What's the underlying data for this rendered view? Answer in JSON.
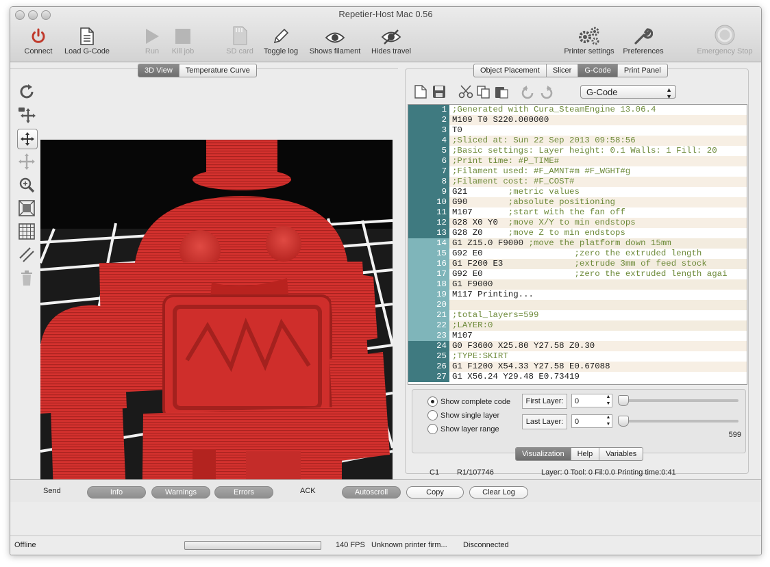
{
  "window": {
    "title": "Repetier-Host Mac 0.56"
  },
  "toolbar": [
    {
      "label": "Connect",
      "icon": "power-icon",
      "enabled": true
    },
    {
      "label": "Load G-Code",
      "icon": "document-icon",
      "enabled": true
    },
    {
      "label": "Run",
      "icon": "play-icon",
      "enabled": false
    },
    {
      "label": "Kill job",
      "icon": "stop-icon",
      "enabled": false
    },
    {
      "label": "SD card",
      "icon": "sd-card-icon",
      "enabled": false
    },
    {
      "label": "Toggle log",
      "icon": "pencil-icon",
      "enabled": true
    },
    {
      "label": "Shows filament",
      "icon": "eye-icon",
      "enabled": true
    },
    {
      "label": "Hides travel",
      "icon": "eye-slash-icon",
      "enabled": true
    },
    {
      "label": "Printer settings",
      "icon": "gears-icon",
      "enabled": true
    },
    {
      "label": "Preferences",
      "icon": "wrench-icon",
      "enabled": true
    },
    {
      "label": "Emergency Stop",
      "icon": "emergency-stop-icon",
      "enabled": false
    }
  ],
  "left_tabs": [
    {
      "label": "3D View",
      "active": true
    },
    {
      "label": "Temperature Curve",
      "active": false
    }
  ],
  "right_tabs": [
    {
      "label": "Object Placement",
      "active": false
    },
    {
      "label": "Slicer",
      "active": false
    },
    {
      "label": "G-Code",
      "active": true
    },
    {
      "label": "Print Panel",
      "active": false
    }
  ],
  "gcode_editor": {
    "file_select": "G-Code",
    "lines": [
      {
        "n": "1",
        "t": ";Generated with Cura_SteamEngine 13.06.4"
      },
      {
        "n": "2",
        "t": "M109 T0 S220.000000"
      },
      {
        "n": "3",
        "t": "T0"
      },
      {
        "n": "4",
        "t": ";Sliced at: Sun 22 Sep 2013 09:58:56"
      },
      {
        "n": "5",
        "t": ";Basic settings: Layer height: 0.1 Walls: 1 Fill: 20"
      },
      {
        "n": "6",
        "t": ";Print time: #P_TIME#"
      },
      {
        "n": "7",
        "t": ";Filament used: #F_AMNT#m #F_WGHT#g"
      },
      {
        "n": "8",
        "t": ";Filament cost: #F_COST#"
      },
      {
        "n": "9",
        "t": "G21        ;metric values"
      },
      {
        "n": "10",
        "t": "G90        ;absolute positioning"
      },
      {
        "n": "11",
        "t": "M107       ;start with the fan off"
      },
      {
        "n": "12",
        "t": "G28 X0 Y0  ;move X/Y to min endstops"
      },
      {
        "n": "13",
        "t": "G28 Z0     ;move Z to min endstops"
      },
      {
        "n": "14",
        "t": "G1 Z15.0 F9000 ;move the platform down 15mm"
      },
      {
        "n": "15",
        "t": "G92 E0                  ;zero the extruded length"
      },
      {
        "n": "16",
        "t": "G1 F200 E3              ;extrude 3mm of feed stock"
      },
      {
        "n": "17",
        "t": "G92 E0                  ;zero the extruded length agai"
      },
      {
        "n": "18",
        "t": "G1 F9000"
      },
      {
        "n": "19",
        "t": "M117 Printing..."
      },
      {
        "n": "20",
        "t": ""
      },
      {
        "n": "21",
        "t": ";total_layers=599"
      },
      {
        "n": "22",
        "t": ";LAYER:0"
      },
      {
        "n": "23",
        "t": "M107"
      },
      {
        "n": "24",
        "t": "G0 F3600 X25.80 Y27.58 Z0.30"
      },
      {
        "n": "25",
        "t": ";TYPE:SKIRT"
      },
      {
        "n": "26",
        "t": "G1 F1200 X54.33 Y27.58 E0.67088"
      },
      {
        "n": "27",
        "t": "G1 X56.24 Y29.48 E0.73419"
      }
    ]
  },
  "visualization": {
    "mode_complete": "Show complete code",
    "mode_single": "Show single layer",
    "mode_range": "Show layer range",
    "first_layer_label": "First Layer:",
    "first_layer_value": "0",
    "last_layer_label": "Last Layer:",
    "last_layer_value": "0",
    "max_layer": "599",
    "tabs": [
      {
        "label": "Visualization",
        "active": true
      },
      {
        "label": "Help",
        "active": false
      },
      {
        "label": "Variables",
        "active": false
      }
    ]
  },
  "editor_status": {
    "cursor": "C1",
    "row": "R1/107746",
    "info": "Layer: 0 Tool: 0 Fil:0.0 Printing time:0:41"
  },
  "log_bar": {
    "send": "Send",
    "info": "Info",
    "warnings": "Warnings",
    "errors": "Errors",
    "ack": "ACK",
    "autoscroll": "Autoscroll",
    "copy": "Copy",
    "clear_log": "Clear Log"
  },
  "statusbar": {
    "connection": "Offline",
    "fps": "140 FPS",
    "firmware": "Unknown printer firm...",
    "state": "Disconnected"
  },
  "colors": {
    "model_red": "#d4312e",
    "gutter_dark": "#3f7a80",
    "gutter_light": "#7fb5ba",
    "comment_green": "#6d8a3a"
  }
}
